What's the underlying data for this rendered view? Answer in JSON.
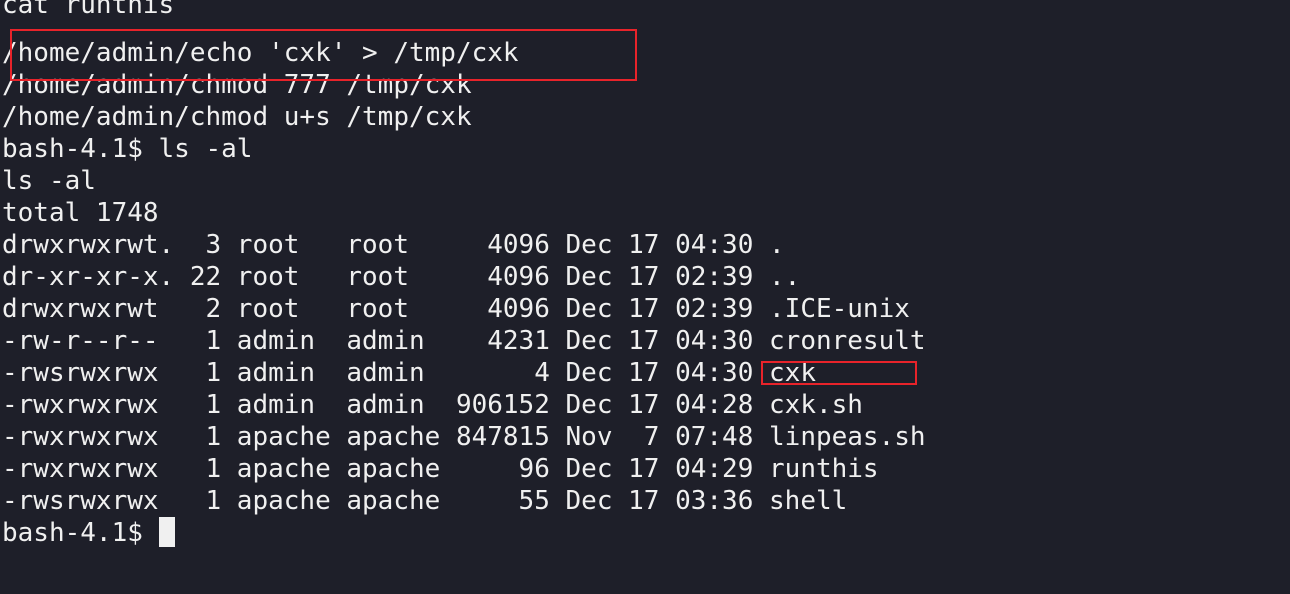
{
  "terminal": {
    "lines": [
      "cat runthis",
      "/home/admin/echo 'cxk' > /tmp/cxk",
      "/home/admin/chmod 777 /tmp/cxk",
      "/home/admin/chmod u+s /tmp/cxk",
      "bash-4.1$ ls -al",
      "ls -al",
      "total 1748",
      "drwxrwxrwt.  3 root   root     4096 Dec 17 04:30 .",
      "dr-xr-xr-x. 22 root   root     4096 Dec 17 02:39 ..",
      "drwxrwxrwt   2 root   root     4096 Dec 17 02:39 .ICE-unix",
      "-rw-r--r--   1 admin  admin    4231 Dec 17 04:30 cronresult",
      "-rwsrwxrwx   1 admin  admin       4 Dec 17 04:30 cxk",
      "-rwxrwxrwx   1 admin  admin  906152 Dec 17 04:28 cxk.sh",
      "-rwxrwxrwx   1 apache apache 847815 Nov  7 07:48 linpeas.sh",
      "-rwxrwxrwx   1 apache apache     96 Dec 17 04:29 runthis",
      "-rwsrwxrwx   1 apache apache     55 Dec 17 03:36 shell"
    ],
    "prompt": "bash-4.1$ "
  },
  "colors": {
    "background": "#1e1f29",
    "foreground": "#f0f0f0",
    "highlight": "#e8232a"
  }
}
